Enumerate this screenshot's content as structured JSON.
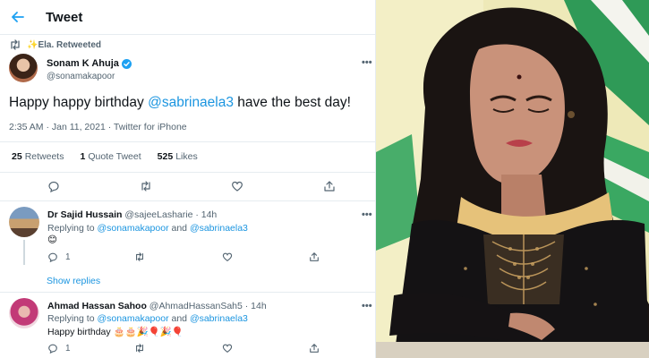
{
  "header": {
    "title": "Tweet",
    "back_icon": "arrow-left-icon"
  },
  "retweet": {
    "label": "✨Ela. Retweeted",
    "icon": "retweet-icon"
  },
  "tweet": {
    "author_name": "Sonam K Ahuja",
    "author_handle": "@sonamakapoor",
    "text_prefix": "Happy happy birthday ",
    "mention": "@sabrinaela3",
    "text_suffix": " have the best day!",
    "meta": "2:35 AM · Jan 11, 2021 · Twitter for iPhone",
    "stats": {
      "retweets_count": "25",
      "retweets_label": "Retweets",
      "quotes_count": "1",
      "quotes_label": "Quote Tweet",
      "likes_count": "525",
      "likes_label": "Likes"
    }
  },
  "replies": [
    {
      "name": "Dr Sajid Hussain",
      "handle": "@sajeeLasharie · 14h",
      "replying_prefix": "Replying to ",
      "replying_handle1": "@sonamakapoor",
      "replying_and": " and ",
      "replying_handle2": "@sabrinaela3",
      "body": "😊",
      "reply_count": "1",
      "show_replies": "Show replies"
    },
    {
      "name": "Ahmad Hassan Sahoo",
      "handle": "@AhmadHassanSah5 · 14h",
      "replying_prefix": "Replying to ",
      "replying_handle1": "@sonamakapoor",
      "replying_and": " and ",
      "replying_handle2": "@sabrinaela3",
      "body": "Happy birthday 🎂🎂🎉🎈🎉🎈",
      "reply_count": "1"
    }
  ],
  "colors": {
    "accent": "#1da1f2",
    "mention": "#1b95e0",
    "secondary": "#536471",
    "divider": "#e6ecf0"
  }
}
